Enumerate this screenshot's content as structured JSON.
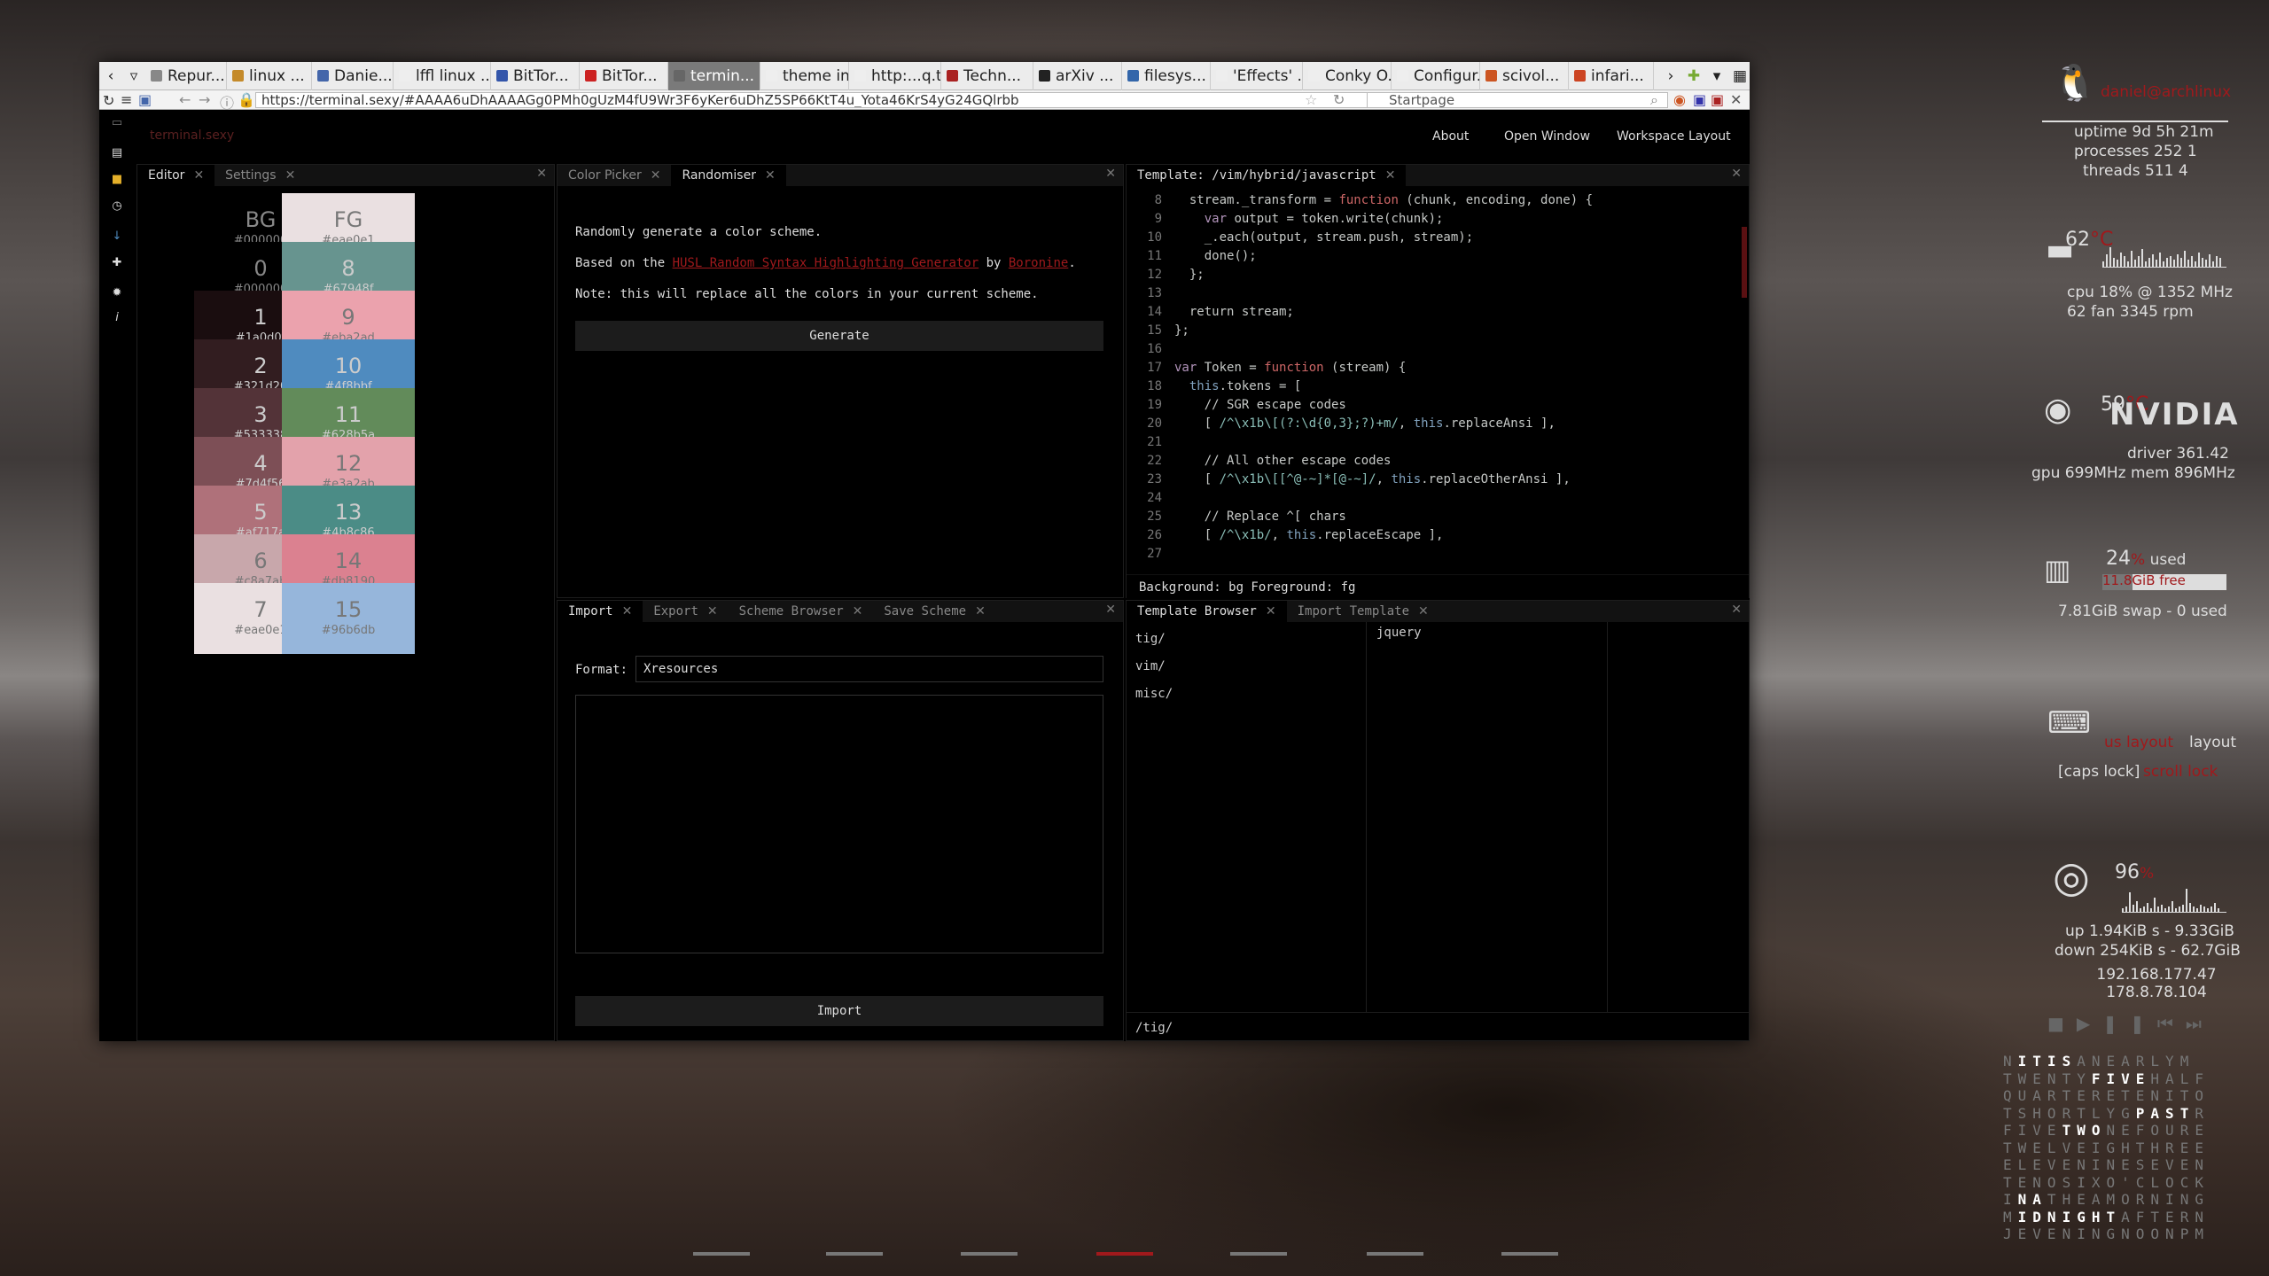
{
  "browser": {
    "tabs": [
      {
        "label": "Repur...",
        "color": "#888",
        "w": 92
      },
      {
        "label": "linux ...",
        "color": "#c48a2a",
        "w": 96
      },
      {
        "label": "Danie...",
        "color": "#4466aa",
        "w": 92
      },
      {
        "label": "lffl linux ...",
        "color": "#eee",
        "w": 110
      },
      {
        "label": "BitTor...",
        "color": "#3355aa",
        "w": 100
      },
      {
        "label": "BitTor...",
        "color": "#cc2222",
        "w": 100
      },
      {
        "label": "termin...",
        "color": "#666",
        "w": 104,
        "active": true
      },
      {
        "label": "theme in...",
        "color": "#eee",
        "w": 100
      },
      {
        "label": "http:...q.txt",
        "color": "#eee",
        "w": 104
      },
      {
        "label": "Techn...",
        "color": "#aa2222",
        "w": 104
      },
      {
        "label": "arXiv ...",
        "color": "#222",
        "w": 100
      },
      {
        "label": "filesys...",
        "color": "#3366aa",
        "w": 100
      },
      {
        "label": "'Effects' ...",
        "color": "#eee",
        "w": 104
      },
      {
        "label": "Conky O...",
        "color": "#eee",
        "w": 100
      },
      {
        "label": "Configur...",
        "color": "#eee",
        "w": 100
      },
      {
        "label": "scivol...",
        "color": "#cc5522",
        "w": 100
      },
      {
        "label": "infari...",
        "color": "#cc4422",
        "w": 96
      }
    ],
    "url": "https://terminal.sexy/#AAAA6uDhAAAAGg0PMh0gUzM4fU9Wr3F6yKer6uDhZ5SP66KtT4u_Yota46KrS4yG24GQlrbb",
    "search": "Startpage"
  },
  "app": {
    "logo": "terminal.sexy",
    "nav": [
      "About",
      "Open Window",
      "Workspace Layout"
    ],
    "editor": {
      "tabs": [
        "Editor",
        "Settings"
      ],
      "bg": {
        "n": "BG",
        "h": "#000000"
      },
      "fg": {
        "n": "FG",
        "h": "#eae0e1"
      },
      "colors": [
        {
          "n": "0",
          "h": "#000000"
        },
        {
          "n": "8",
          "h": "#67948f"
        },
        {
          "n": "1",
          "h": "#1a0d0f"
        },
        {
          "n": "9",
          "h": "#eba2ad"
        },
        {
          "n": "2",
          "h": "#321d20"
        },
        {
          "n": "10",
          "h": "#4f8bbf"
        },
        {
          "n": "3",
          "h": "#533338"
        },
        {
          "n": "11",
          "h": "#628b5a"
        },
        {
          "n": "4",
          "h": "#7d4f56"
        },
        {
          "n": "12",
          "h": "#e3a2ab"
        },
        {
          "n": "5",
          "h": "#af717a"
        },
        {
          "n": "13",
          "h": "#4b8c86"
        },
        {
          "n": "6",
          "h": "#c8a7ab"
        },
        {
          "n": "14",
          "h": "#db8190"
        },
        {
          "n": "7",
          "h": "#eae0e1"
        },
        {
          "n": "15",
          "h": "#96b6db"
        }
      ]
    },
    "randomiser": {
      "tabs": [
        "Color Picker",
        "Randomiser"
      ],
      "line1": "Randomly generate a color scheme.",
      "based_pre": "Based on the ",
      "based_link": "HUSL Random Syntax Highlighting Generator",
      "based_mid": " by ",
      "based_author": "Boronine",
      "based_end": ".",
      "note": "Note: this will replace all the colors in your current scheme.",
      "button": "Generate"
    },
    "template": {
      "tabs": [
        "Template: /vim/hybrid/javascript"
      ],
      "footer": "Background: bg Foreground: fg"
    },
    "import": {
      "tabs": [
        "Import",
        "Export",
        "Scheme Browser",
        "Save Scheme"
      ],
      "format_label": "Format:",
      "format_value": "Xresources",
      "button": "Import"
    },
    "browser": {
      "tabs": [
        "Template Browser",
        "Import Template"
      ],
      "col1": [
        "tig/",
        "vim/",
        "misc/"
      ],
      "col2": [
        "jquery"
      ],
      "path": "/tig/"
    }
  },
  "conky": {
    "user_host": "daniel@archlinux",
    "uptime": "uptime 9d 5h 21m",
    "processes": "processes 252   1",
    "threads": "threads 511   4",
    "cpu_temp": "62",
    "cpu": "cpu 18% @ 1352 MHz",
    "fan": "62   fan 3345 rpm",
    "gpu_temp": "59",
    "nvidia": "NVIDIA",
    "driver": "driver   361.42",
    "gpu": "gpu  699MHz  mem  896MHz",
    "ram_pct": "24",
    "ram_used": "used",
    "ram_free": "11.8GiB free",
    "swap": "7.81GiB swap - 0    used",
    "kb_layout": "layout",
    "kb_red": "us layout",
    "caps": "[caps lock]",
    "caps_red": "scroll lock",
    "wifi_pct": "96",
    "net_up": "up 1.94KiB  s - 9.33GiB",
    "net_down": "down 254KiB  s - 62.7GiB",
    "ip": "192.168.177.47    178.8.78.104",
    "word_clock": [
      "NITISANEARLYM",
      "TWENTYFIVEHALF",
      "QUARTERETENITO",
      "TSHORTLYGPASTR",
      "FIVETWONEFOURE",
      "TWELVEIGHTHREE",
      "ELEVENINESEVEN",
      "TENOSIXO'CLOCK",
      "INATHEAMORNING",
      "MIDNIGHTAFTERN",
      "JEVENINGNOONPM"
    ]
  }
}
